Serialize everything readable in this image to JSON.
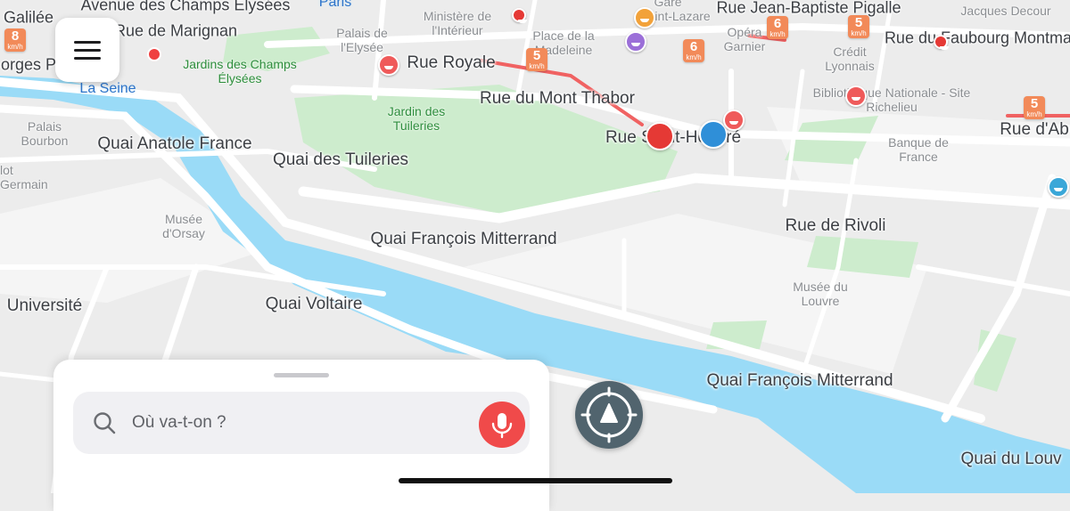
{
  "map": {
    "streets": [
      {
        "id": "champs",
        "text": "Avenue des Champs Elysées"
      },
      {
        "id": "galilee",
        "text": "Galilée"
      },
      {
        "id": "marignan",
        "text": "Rue de Marignan"
      },
      {
        "id": "georges",
        "text": "orges P"
      },
      {
        "id": "royale",
        "text": "Rue Royale"
      },
      {
        "id": "thabor",
        "text": "Rue du Mont Thabor"
      },
      {
        "id": "sthonore",
        "text": "Rue Saint-Honoré"
      },
      {
        "id": "anatole",
        "text": "Quai Anatole France"
      },
      {
        "id": "tuileries",
        "text": "Quai des Tuileries"
      },
      {
        "id": "mitterrand1",
        "text": "Quai François Mitterrand"
      },
      {
        "id": "rivoli",
        "text": "Rue de Rivoli"
      },
      {
        "id": "universite",
        "text": "Université"
      },
      {
        "id": "voltaire",
        "text": "Quai Voltaire"
      },
      {
        "id": "mitterrand2",
        "text": "Quai François Mitterrand"
      },
      {
        "id": "louvre_quai",
        "text": "Quai du Louv"
      },
      {
        "id": "pigalle",
        "text": "Rue Jean-Baptiste Pigalle"
      },
      {
        "id": "decour",
        "text": "Jacques Decour"
      },
      {
        "id": "faubourg",
        "text": "Rue du Faubourg Montma"
      },
      {
        "id": "abo",
        "text": "Rue d'Ab"
      }
    ],
    "pois": [
      {
        "id": "paris",
        "text": "Paris"
      },
      {
        "id": "gare",
        "text": "Gare"
      },
      {
        "id": "stlazare",
        "text": "Saint-Lazare"
      },
      {
        "id": "ministere",
        "text": "Ministère de l'Intérieur"
      },
      {
        "id": "palais_elysee",
        "text": "Palais de l'Elysée"
      },
      {
        "id": "madeleine",
        "text": "Place de la Madeleine"
      },
      {
        "id": "opera",
        "text": "Opéra Garnier"
      },
      {
        "id": "credit",
        "text": "Crédit Lyonnais"
      },
      {
        "id": "bnf",
        "text": "Bibliothèque Nationale - Site Richelieu"
      },
      {
        "id": "banque",
        "text": "Banque de France"
      },
      {
        "id": "palais_bourbon",
        "text": "Palais Bourbon"
      },
      {
        "id": "stgermain",
        "text": "lot Germain"
      },
      {
        "id": "orsay",
        "text": "Musée d'Orsay"
      },
      {
        "id": "musee_louvre",
        "text": "Musée du Louvre"
      }
    ],
    "parks": [
      {
        "id": "jardins_ce",
        "text": "Jardins des Champs Élysées"
      },
      {
        "id": "jardin_tuileries",
        "text": "Jardin des Tuileries"
      }
    ],
    "water": [
      {
        "id": "seine",
        "text": "La Seine"
      }
    ],
    "speed_limits": [
      {
        "value": "8",
        "unit": "km/h"
      },
      {
        "value": "5",
        "unit": "km/h"
      },
      {
        "value": "6",
        "unit": "km/h"
      },
      {
        "value": "6",
        "unit": "km/h"
      },
      {
        "value": "5",
        "unit": "km/h"
      },
      {
        "value": "5",
        "unit": "km/h"
      }
    ],
    "colors": {
      "water": "#9adbf7",
      "park": "#cdeccd",
      "road": "#ffffff",
      "land": "#ececec",
      "traffic": "#f06262"
    }
  },
  "menu": {
    "icon": "hamburger-menu-icon",
    "has_notification": true
  },
  "search": {
    "placeholder": "Où va-t-on ?",
    "icon": "search-icon",
    "mic_icon": "microphone-icon",
    "accent": "#f04a4a"
  },
  "locate": {
    "icon": "recenter-navigation-icon"
  }
}
